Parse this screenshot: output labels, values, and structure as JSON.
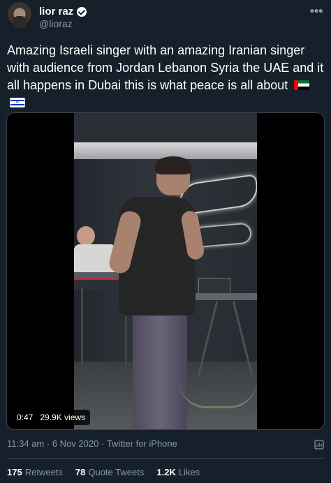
{
  "author": {
    "name": "lior raz",
    "handle": "@lioraz"
  },
  "more_icon": "more-horizontal-icon",
  "tweet": {
    "text": "Amazing Israeli singer with an amazing Iranian singer with audience from Jordan Lebanon Syria the UAE and it all happens in Dubai this is what peace is all about",
    "flags": [
      "UAE",
      "Israel"
    ]
  },
  "video": {
    "duration": "0:47",
    "views": "29.9K views"
  },
  "meta": {
    "time": "11:34 am",
    "date": "6 Nov 2020",
    "source": "Twitter for iPhone",
    "separator": "·"
  },
  "stats": {
    "retweets_count": "175",
    "retweets_label": "Retweets",
    "quote_count": "78",
    "quote_label": "Quote Tweets",
    "likes_count": "1.2K",
    "likes_label": "Likes"
  },
  "colors": {
    "background": "#15202b",
    "secondary_text": "#8899a6",
    "divider": "#38444d"
  }
}
